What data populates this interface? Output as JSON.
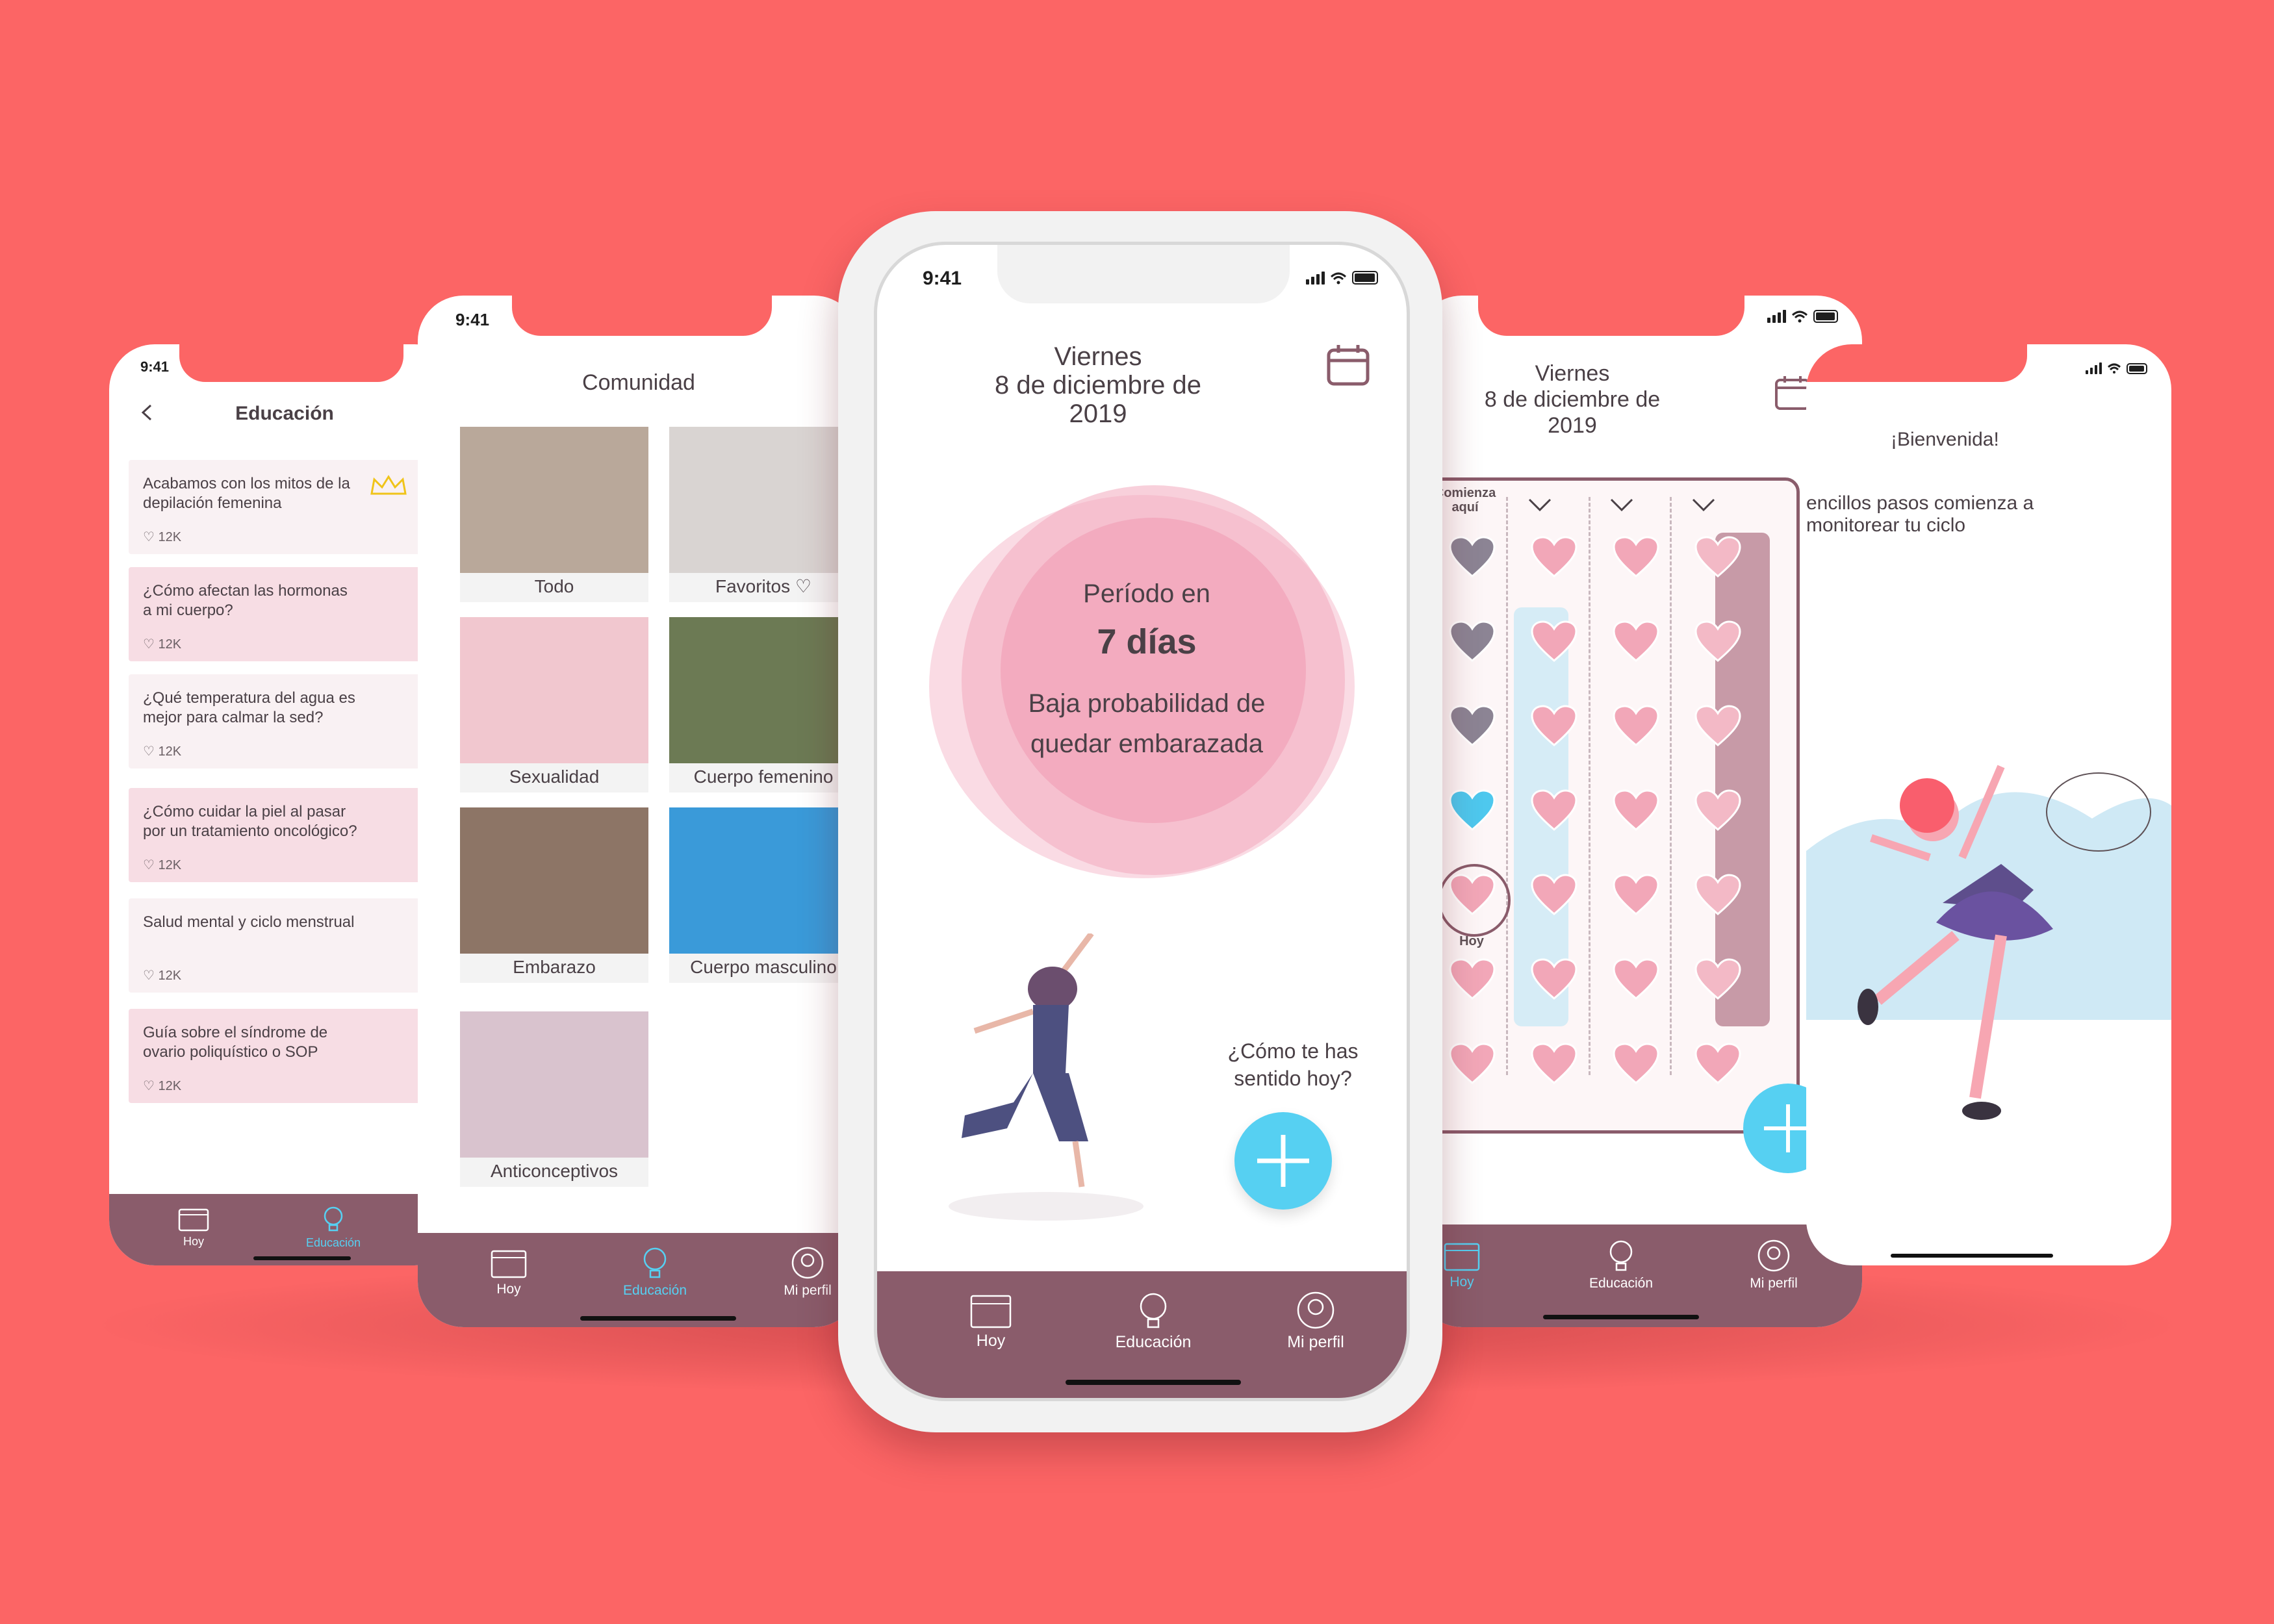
{
  "colors": {
    "background": "#fc6565",
    "tabbar": "#8a5c6b",
    "active": "#56d0f2",
    "pink": "#f2a7b8",
    "mauve": "#c59aa5",
    "grey_heart": "#8c8494",
    "blue_heart": "#4ec8ee"
  },
  "status_time": "9:41",
  "tabs": {
    "today": "Hoy",
    "education": "Educación",
    "profile": "Mi perfil"
  },
  "education_screen": {
    "title": "Educación",
    "back_icon": "chevron-left-icon",
    "articles": [
      {
        "text": "Acabamos con los mitos de la depilación femenina",
        "likes": "12K",
        "premium": true
      },
      {
        "text": "¿Cómo afectan las hormonas a mi cuerpo?",
        "likes": "12K"
      },
      {
        "text": "¿Qué temperatura del agua es mejor para calmar la sed?",
        "likes": "12K"
      },
      {
        "text": "¿Cómo cuidar la piel al pasar por un tratamiento oncológico?",
        "likes": "12K"
      },
      {
        "text": "Salud mental y ciclo menstrual",
        "likes": "12K"
      },
      {
        "text": "Guía sobre el síndrome de ovario poliquístico o SOP",
        "likes": "12K"
      }
    ]
  },
  "community_screen": {
    "title": "Comunidad",
    "categories": [
      {
        "label": "Todo",
        "color": "#b9a89a"
      },
      {
        "label": "Favoritos ♡",
        "color": "#d9d4d2"
      },
      {
        "label": "Sexualidad",
        "color": "#f1c7cf"
      },
      {
        "label": "Cuerpo femenino",
        "color": "#6c7a54"
      },
      {
        "label": "Embarazo",
        "color": "#8d7566"
      },
      {
        "label": "Cuerpo masculino",
        "color": "#3a9ad9"
      },
      {
        "label": "Anticonceptivos",
        "color": "#d9c3ce"
      }
    ]
  },
  "home_screen": {
    "day": "Viernes",
    "date": "8 de diciembre de 2019",
    "period_label": "Período en",
    "period_days": "7 días",
    "probability": "Baja probabilidad de quedar embarazada",
    "prompt": "¿Cómo te has sentido hoy?"
  },
  "calendar_screen": {
    "day": "Viernes",
    "date": "8 de diciembre de 2019",
    "start_label": "Comienza aquí",
    "today_label": "Hoy"
  },
  "welcome_screen": {
    "greeting": "¡Bienvenida!",
    "subtitle": "encillos pasos comienza a monitorear tu ciclo"
  }
}
